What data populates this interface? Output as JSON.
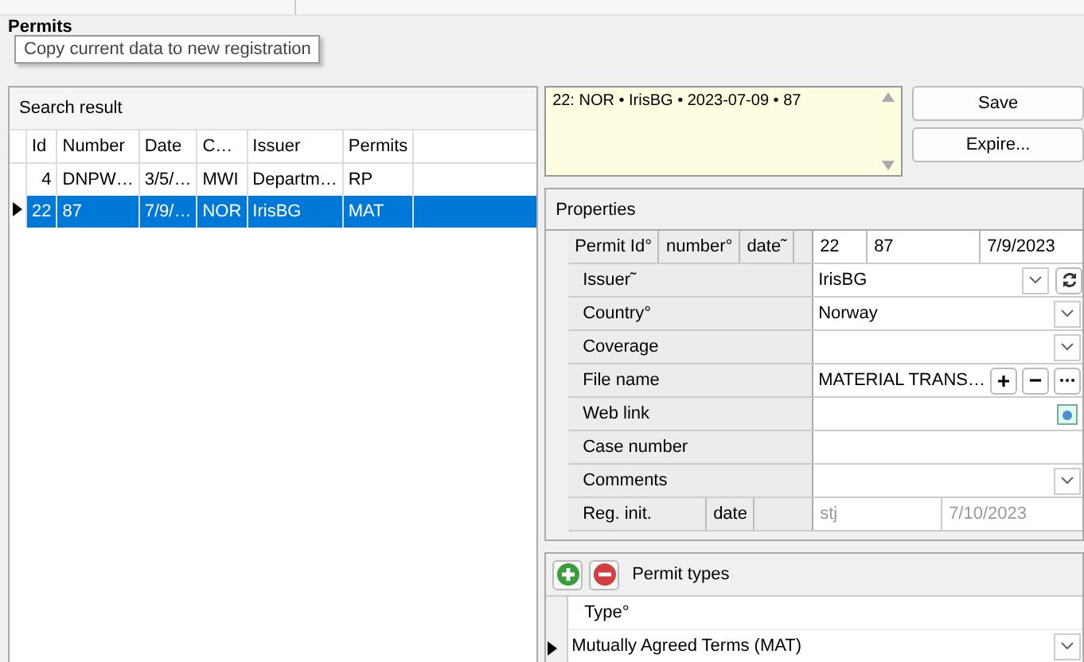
{
  "title": "Permits",
  "tooltip": "Copy current data to new registration",
  "search_result": {
    "title": "Search result",
    "columns": [
      "Id",
      "Number",
      "Date",
      "C…",
      "Issuer",
      "Permits"
    ],
    "rows": [
      {
        "cells": [
          "4",
          "DNPW…",
          "3/5/…",
          "MWI",
          "Departm…",
          "RP"
        ],
        "selected": false
      },
      {
        "cells": [
          "22",
          "87",
          "7/9/…",
          "NOR",
          "IrisBG",
          "MAT"
        ],
        "selected": true
      }
    ]
  },
  "summary": "22: NOR • IrisBG • 2023-07-09 • 87",
  "buttons": [
    "Save",
    "Expire..."
  ],
  "properties": {
    "title": "Properties",
    "rows": [
      {
        "kind": "triple",
        "labels": [
          "Permit Id°",
          "number°",
          "date˜"
        ],
        "values": [
          "22",
          "87",
          "7/9/2023"
        ]
      },
      {
        "kind": "combo_refresh",
        "label": "Issuer˜",
        "value": "IrisBG"
      },
      {
        "kind": "combo",
        "label": "Country°",
        "value": "Norway"
      },
      {
        "kind": "combo",
        "label": "Coverage"
      },
      {
        "kind": "file",
        "label": "File name",
        "value": "MATERIAL TRANS…"
      },
      {
        "kind": "link",
        "label": "Web link"
      },
      {
        "kind": "text",
        "label": "Case number"
      },
      {
        "kind": "combo",
        "label": "Comments"
      },
      {
        "kind": "pair_disabled",
        "labels": [
          "Reg. init.",
          "date"
        ],
        "values": [
          "stj",
          "7/10/2023"
        ]
      }
    ]
  },
  "permit_types": {
    "title": "Permit types",
    "column": "Type°",
    "rows": [
      {
        "value": "Mutually Agreed Terms (MAT)",
        "selected": true
      }
    ]
  }
}
